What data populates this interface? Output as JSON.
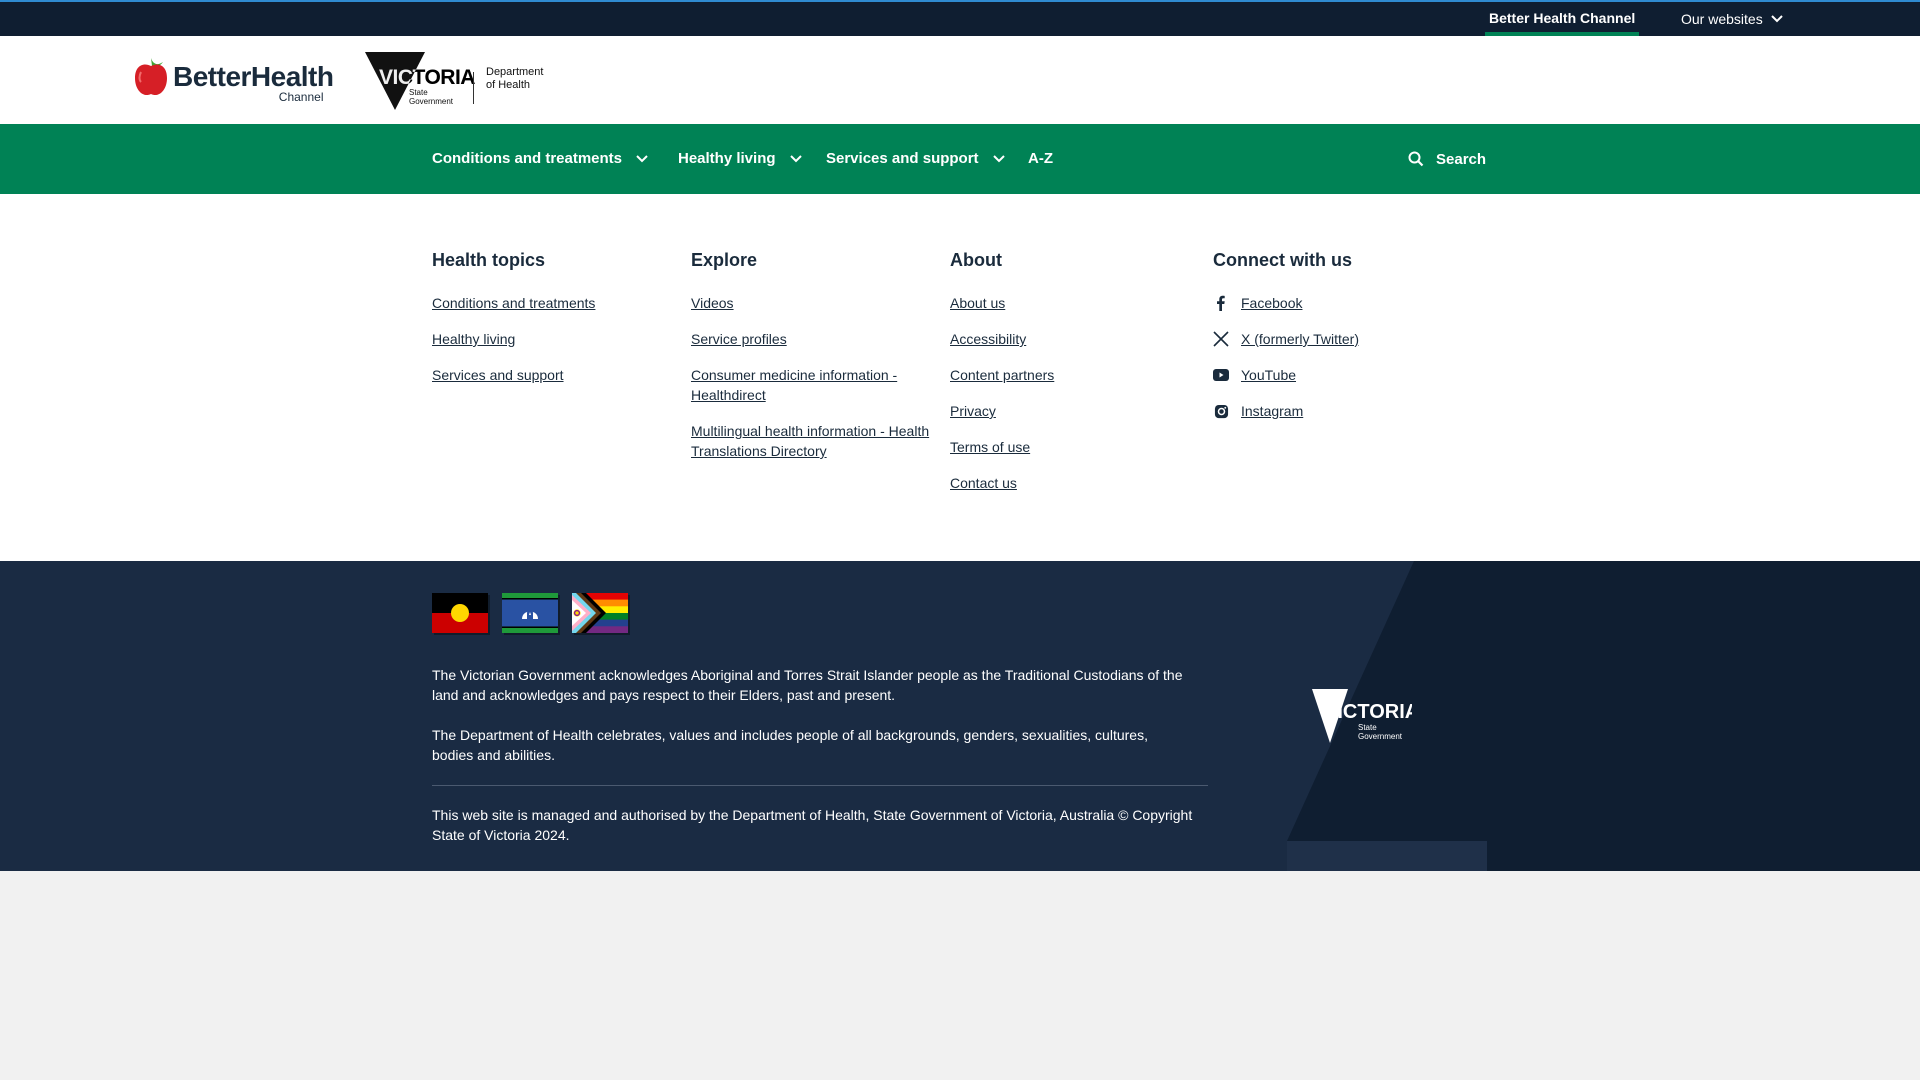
{
  "topbar": {
    "current_site": "Better Health Channel",
    "our_websites": "Our websites"
  },
  "header": {
    "logo_main": "BetterHealth",
    "logo_sub": "Channel",
    "vic_word": "VICTORIA",
    "vic_sub_1": "State",
    "vic_sub_2": "Government",
    "dept_1": "Department",
    "dept_2": "of Health"
  },
  "nav": {
    "items": [
      {
        "label": "Conditions and treatments"
      },
      {
        "label": "Healthy living"
      },
      {
        "label": "Services and support"
      },
      {
        "label": "A-Z"
      }
    ],
    "search": "Search"
  },
  "footer": {
    "health_topics": {
      "heading": "Health topics",
      "links": [
        "Conditions and treatments",
        "Healthy living",
        "Services and support"
      ]
    },
    "explore": {
      "heading": "Explore",
      "links": [
        "Videos",
        "Service profiles",
        "Consumer medicine information - Healthdirect",
        "Multilingual health information - Health Translations Directory"
      ]
    },
    "about": {
      "heading": "About",
      "links": [
        "About us",
        "Accessibility",
        "Content partners",
        "Privacy",
        "Terms of use",
        "Contact us"
      ]
    },
    "connect": {
      "heading": "Connect with us",
      "links": [
        {
          "label": "Facebook",
          "icon": "facebook-icon"
        },
        {
          "label": "X (formerly Twitter)",
          "icon": "x-icon"
        },
        {
          "label": "YouTube",
          "icon": "youtube-icon"
        },
        {
          "label": "Instagram",
          "icon": "instagram-icon"
        }
      ]
    },
    "ack_1": "The Victorian Government acknowledges Aboriginal and Torres Strait Islander people as the Traditional Custodians of the land and acknowledges and pays respect to their Elders, past and present.",
    "ack_2": "The Department of Health celebrates, values and includes people of all backgrounds, genders, sexualities, cultures, bodies and abilities.",
    "copyright": "This web site is managed and authorised by the Department of Health, State Government of Victoria, Australia © Copyright State of Victoria 2024.",
    "vic_word": "VICTORIA",
    "vic_sub_1": "State",
    "vic_sub_2": "Government"
  },
  "colors": {
    "nav_green": "#008255",
    "topbar_navy": "#0f1e31",
    "footer_navy": "#1a2b43",
    "accent_blue": "#2f8bd1"
  }
}
